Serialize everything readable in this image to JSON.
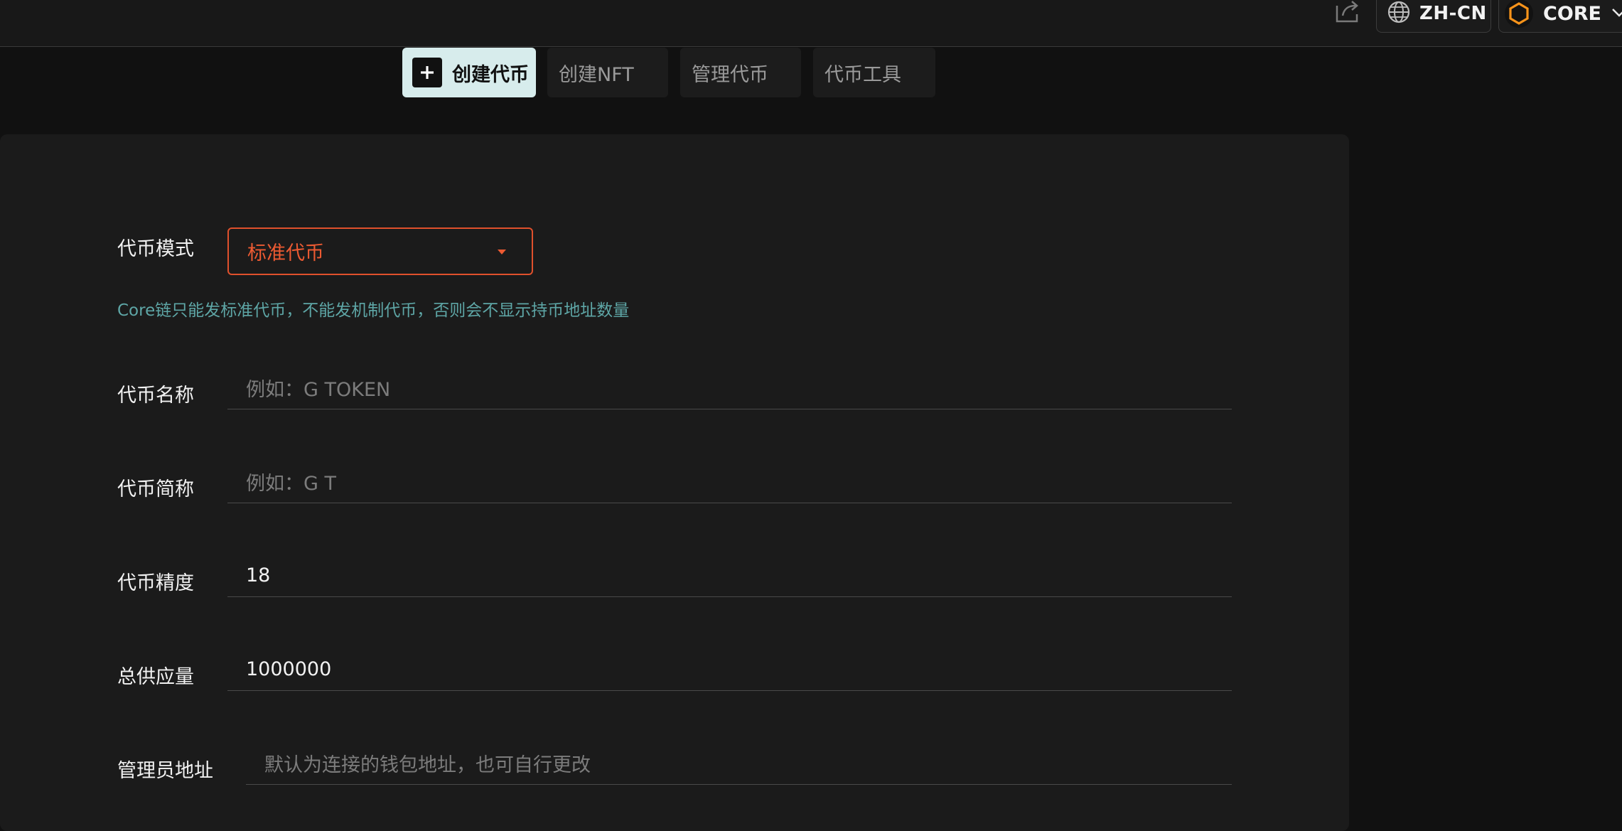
{
  "header": {
    "share_icon": "share-icon",
    "language": {
      "icon": "globe-icon",
      "label": "ZH-CN"
    },
    "chain": {
      "icon": "core-hexagon-logo",
      "label": "CORE",
      "accent": "#f7931a"
    }
  },
  "tabs": [
    {
      "label": "创建代币",
      "active": true,
      "icon": "plus-square-icon"
    },
    {
      "label": "创建NFT",
      "active": false
    },
    {
      "label": "管理代币",
      "active": false
    },
    {
      "label": "代币工具",
      "active": false
    }
  ],
  "form": {
    "token_mode": {
      "label": "代币模式",
      "selected": "标准代币",
      "hint": "Core链只能发标准代币，不能发机制代币，否则会不显示持币地址数量"
    },
    "token_name": {
      "label": "代币名称",
      "placeholder": "例如：G TOKEN",
      "value": ""
    },
    "token_symbol": {
      "label": "代币简称",
      "placeholder": "例如：G T",
      "value": ""
    },
    "token_decimals": {
      "label": "代币精度",
      "value": "18"
    },
    "total_supply": {
      "label": "总供应量",
      "value": "1000000"
    },
    "admin_address": {
      "label": "管理员地址",
      "placeholder": "默认为连接的钱包地址，也可自行更改",
      "value": ""
    }
  },
  "colors": {
    "accent_red": "#ec5a32",
    "hint_teal": "#5ea6a6",
    "active_tab_bg": "#d7ecec"
  }
}
